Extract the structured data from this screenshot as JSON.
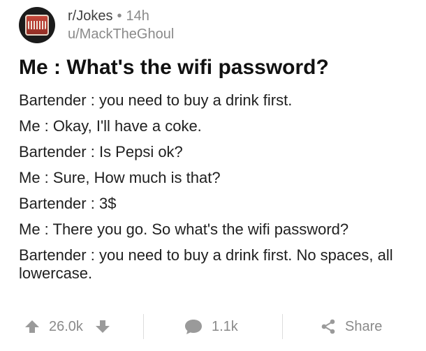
{
  "post": {
    "subreddit": "r/Jokes",
    "dot": "•",
    "time": "14h",
    "author": "u/MackTheGhoul",
    "title": "Me : What's the wifi password?",
    "body": [
      "Bartender : you need to buy a drink first.",
      "Me : Okay, I'll have a coke.",
      "Bartender : Is Pepsi ok?",
      "Me : Sure, How much is that?",
      "Bartender : 3$",
      "Me : There you go. So what's the wifi password?",
      "Bartender : you need to buy a drink first. No spaces, all lowercase."
    ]
  },
  "footer": {
    "upvotes": "26.0k",
    "comments": "1.1k",
    "share_label": "Share"
  },
  "icons": {
    "avatar": "subreddit-avatar-icon",
    "upvote": "upvote-arrow-icon",
    "downvote": "downvote-arrow-icon",
    "comment": "comment-bubble-icon",
    "share": "share-icon"
  },
  "colors": {
    "text": "#1a1a1a",
    "muted": "#8a8a8a",
    "divider": "#dddddd"
  }
}
